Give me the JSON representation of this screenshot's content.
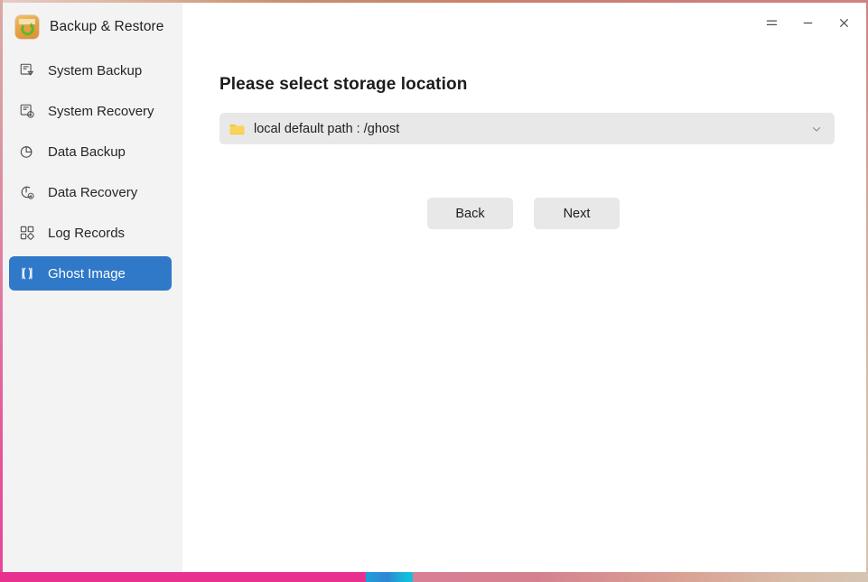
{
  "window": {
    "app_title": "Backup & Restore",
    "app_icon": "backup-restore-logo-icon",
    "controls": [
      {
        "name": "menu-button",
        "icon": "hamburger-menu-icon",
        "label": "≡"
      },
      {
        "name": "minimize-button",
        "icon": "minimize-icon",
        "label": "−"
      },
      {
        "name": "close-button",
        "icon": "close-icon",
        "label": "×"
      }
    ]
  },
  "sidebar": {
    "items": [
      {
        "label": "System Backup",
        "icon": "system-backup-icon",
        "selected": false
      },
      {
        "label": "System Recovery",
        "icon": "system-recovery-icon",
        "selected": false
      },
      {
        "label": "Data Backup",
        "icon": "data-backup-icon",
        "selected": false
      },
      {
        "label": "Data Recovery",
        "icon": "data-recovery-icon",
        "selected": false
      },
      {
        "label": "Log Records",
        "icon": "log-records-icon",
        "selected": false
      },
      {
        "label": "Ghost Image",
        "icon": "ghost-image-icon",
        "selected": true
      }
    ],
    "selected_bg": "#3078c8",
    "background": "#f3f3f3"
  },
  "main": {
    "title": "Please select storage location",
    "storage_select": {
      "value": "local default path : /ghost",
      "icon": "folder-icon",
      "chevron": "chevron-down-icon",
      "background": "#e8e8e8"
    },
    "buttons": {
      "back": "Back",
      "next": "Next"
    }
  },
  "decoration": {
    "bottom_bar_color": "#e8308f",
    "bottom_accent_color": "#12c2dd"
  }
}
